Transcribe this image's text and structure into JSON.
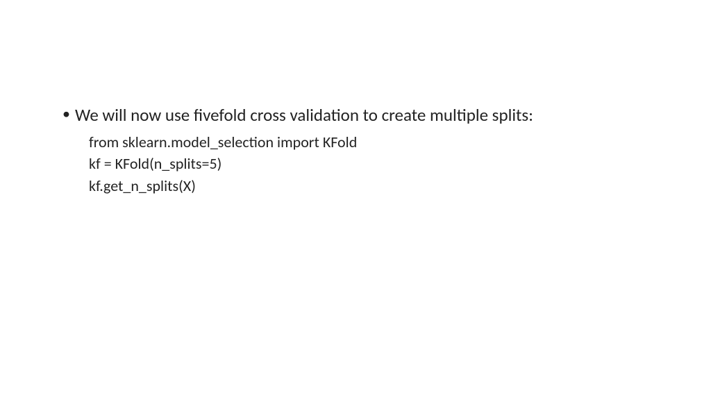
{
  "slide": {
    "bullet": "We will now use fivefold cross validation to create multiple splits:",
    "code": {
      "line1": "from sklearn.model_selection import KFold",
      "line2": "kf = KFold(n_splits=5)",
      "line3": "kf.get_n_splits(X)"
    }
  }
}
